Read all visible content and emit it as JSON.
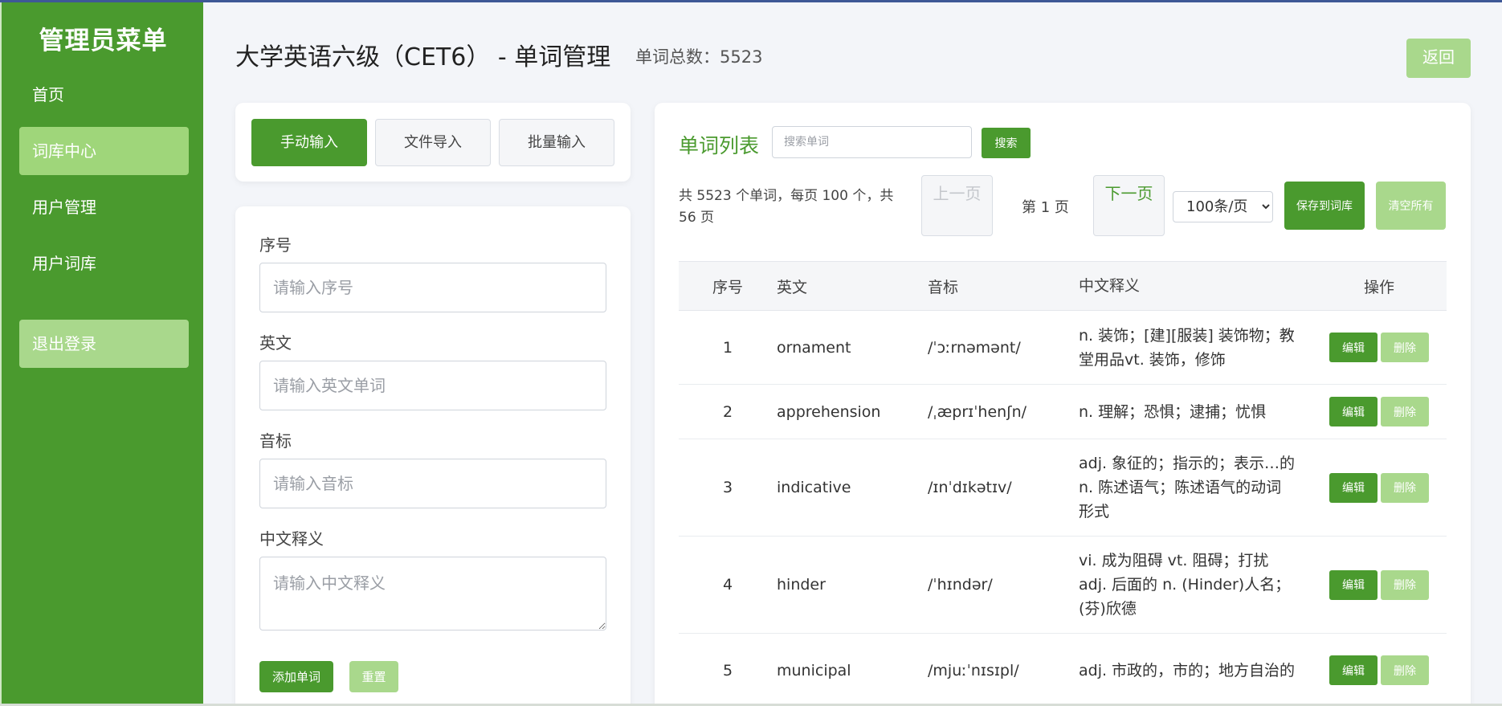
{
  "sidebar": {
    "title": "管理员菜单",
    "items": [
      {
        "label": "首页"
      },
      {
        "label": "词库中心"
      },
      {
        "label": "用户管理"
      },
      {
        "label": "用户词库"
      }
    ],
    "logout": "退出登录"
  },
  "header": {
    "title": "大学英语六级（CET6） - 单词管理",
    "word_count": "单词总数：5523",
    "back": "返回"
  },
  "input_tabs": [
    "手动输入",
    "文件导入",
    "批量输入"
  ],
  "form": {
    "fields": [
      {
        "label": "序号",
        "placeholder": "请输入序号"
      },
      {
        "label": "英文",
        "placeholder": "请输入英文单词"
      },
      {
        "label": "音标",
        "placeholder": "请输入音标"
      },
      {
        "label": "中文释义",
        "placeholder": "请输入中文释义"
      }
    ],
    "add": "添加单词",
    "reset": "重置"
  },
  "list": {
    "title": "单词列表",
    "search_placeholder": "搜索单词",
    "search": "搜索",
    "pager_info": "共 5523 个单词，每页 100 个，共 56 页",
    "prev": "上一页",
    "page": "第 1 页",
    "next": "下一页",
    "page_size": "100条/页",
    "save": "保存到词库",
    "clear": "清空所有",
    "columns": [
      "序号",
      "英文",
      "音标",
      "中文释义",
      "操作"
    ],
    "rows": [
      {
        "num": "1",
        "en": "ornament",
        "ph": "/ˈɔːrnəmənt/",
        "zh": "n. 装饰；[建][服装] 装饰物；教堂用品vt. 装饰，修饰"
      },
      {
        "num": "2",
        "en": "apprehension",
        "ph": "/ˌæprɪˈhenʃn/",
        "zh": "n. 理解；恐惧；逮捕；忧惧"
      },
      {
        "num": "3",
        "en": "indicative",
        "ph": "/ɪnˈdɪkətɪv/",
        "zh": "adj. 象征的；指示的；表示…的n. 陈述语气；陈述语气的动词形式"
      },
      {
        "num": "4",
        "en": "hinder",
        "ph": "/ˈhɪndər/",
        "zh": "vi. 成为阻碍 vt. 阻碍；打扰adj. 后面的 n. (Hinder)人名；(芬)欣德"
      },
      {
        "num": "5",
        "en": "municipal",
        "ph": "/mjuːˈnɪsɪpl/",
        "zh": "adj. 市政的，市的；地方自治的"
      }
    ],
    "edit": "编辑",
    "delete": "删除"
  }
}
